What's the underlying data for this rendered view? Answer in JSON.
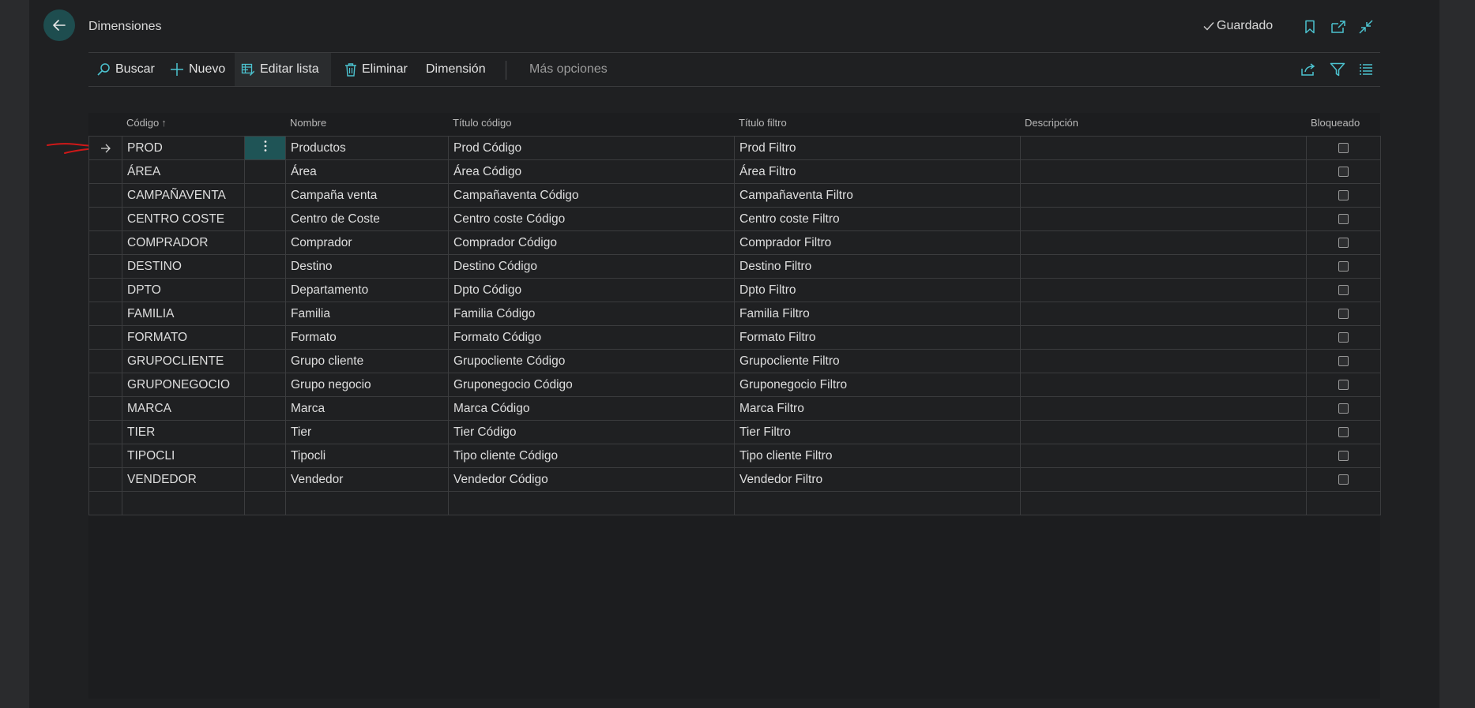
{
  "header": {
    "title": "Dimensiones",
    "saved_label": "Guardado"
  },
  "toolbar": {
    "search_label": "Buscar",
    "new_label": "Nuevo",
    "edit_list_label": "Editar lista",
    "delete_label": "Eliminar",
    "dimension_label": "Dimensión",
    "more_options_label": "Más opciones"
  },
  "table": {
    "columns": [
      "Código",
      "Nombre",
      "Título código",
      "Título filtro",
      "Descripción",
      "Bloqueado"
    ],
    "sort_indicator": "↑",
    "rows": [
      {
        "code": "PROD",
        "name": "Productos",
        "code_caption": "Prod Código",
        "filter_caption": "Prod Filtro",
        "description": "",
        "blocked": false
      },
      {
        "code": "ÁREA",
        "name": "Área",
        "code_caption": "Área Código",
        "filter_caption": "Área Filtro",
        "description": "",
        "blocked": false
      },
      {
        "code": "CAMPAÑAVENTA",
        "name": "Campaña venta",
        "code_caption": "Campañaventa Código",
        "filter_caption": "Campañaventa Filtro",
        "description": "",
        "blocked": false
      },
      {
        "code": "CENTRO COSTE",
        "name": "Centro de Coste",
        "code_caption": "Centro coste Código",
        "filter_caption": "Centro coste Filtro",
        "description": "",
        "blocked": false
      },
      {
        "code": "COMPRADOR",
        "name": "Comprador",
        "code_caption": "Comprador Código",
        "filter_caption": "Comprador Filtro",
        "description": "",
        "blocked": false
      },
      {
        "code": "DESTINO",
        "name": "Destino",
        "code_caption": "Destino Código",
        "filter_caption": "Destino Filtro",
        "description": "",
        "blocked": false
      },
      {
        "code": "DPTO",
        "name": "Departamento",
        "code_caption": "Dpto Código",
        "filter_caption": "Dpto Filtro",
        "description": "",
        "blocked": false
      },
      {
        "code": "FAMILIA",
        "name": "Familia",
        "code_caption": "Familia Código",
        "filter_caption": "Familia Filtro",
        "description": "",
        "blocked": false
      },
      {
        "code": "FORMATO",
        "name": "Formato",
        "code_caption": "Formato Código",
        "filter_caption": "Formato Filtro",
        "description": "",
        "blocked": false
      },
      {
        "code": "GRUPOCLIENTE",
        "name": "Grupo cliente",
        "code_caption": "Grupocliente Código",
        "filter_caption": "Grupocliente Filtro",
        "description": "",
        "blocked": false
      },
      {
        "code": "GRUPONEGOCIO",
        "name": "Grupo negocio",
        "code_caption": "Gruponegocio Código",
        "filter_caption": "Gruponegocio Filtro",
        "description": "",
        "blocked": false
      },
      {
        "code": "MARCA",
        "name": "Marca",
        "code_caption": "Marca Código",
        "filter_caption": "Marca Filtro",
        "description": "",
        "blocked": false
      },
      {
        "code": "TIER",
        "name": "Tier",
        "code_caption": "Tier Código",
        "filter_caption": "Tier Filtro",
        "description": "",
        "blocked": false
      },
      {
        "code": "TIPOCLI",
        "name": "Tipocli",
        "code_caption": "Tipo cliente Código",
        "filter_caption": "Tipo cliente Filtro",
        "description": "",
        "blocked": false
      },
      {
        "code": "VENDEDOR",
        "name": "Vendedor",
        "code_caption": "Vendedor Código",
        "filter_caption": "Vendedor Filtro",
        "description": "",
        "blocked": false
      }
    ]
  },
  "colors": {
    "accent": "#1e4d4f",
    "icon_accent": "#4cc3d0",
    "annotation_red": "#d01818"
  }
}
